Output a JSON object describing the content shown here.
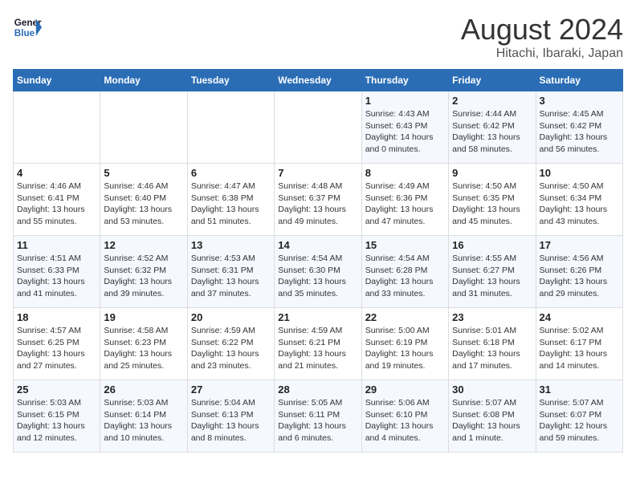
{
  "header": {
    "logo_line1": "General",
    "logo_line2": "Blue",
    "title": "August 2024",
    "subtitle": "Hitachi, Ibaraki, Japan"
  },
  "weekdays": [
    "Sunday",
    "Monday",
    "Tuesday",
    "Wednesday",
    "Thursday",
    "Friday",
    "Saturday"
  ],
  "weeks": [
    [
      {
        "day": "",
        "detail": ""
      },
      {
        "day": "",
        "detail": ""
      },
      {
        "day": "",
        "detail": ""
      },
      {
        "day": "",
        "detail": ""
      },
      {
        "day": "1",
        "detail": "Sunrise: 4:43 AM\nSunset: 6:43 PM\nDaylight: 14 hours\nand 0 minutes."
      },
      {
        "day": "2",
        "detail": "Sunrise: 4:44 AM\nSunset: 6:42 PM\nDaylight: 13 hours\nand 58 minutes."
      },
      {
        "day": "3",
        "detail": "Sunrise: 4:45 AM\nSunset: 6:42 PM\nDaylight: 13 hours\nand 56 minutes."
      }
    ],
    [
      {
        "day": "4",
        "detail": "Sunrise: 4:46 AM\nSunset: 6:41 PM\nDaylight: 13 hours\nand 55 minutes."
      },
      {
        "day": "5",
        "detail": "Sunrise: 4:46 AM\nSunset: 6:40 PM\nDaylight: 13 hours\nand 53 minutes."
      },
      {
        "day": "6",
        "detail": "Sunrise: 4:47 AM\nSunset: 6:38 PM\nDaylight: 13 hours\nand 51 minutes."
      },
      {
        "day": "7",
        "detail": "Sunrise: 4:48 AM\nSunset: 6:37 PM\nDaylight: 13 hours\nand 49 minutes."
      },
      {
        "day": "8",
        "detail": "Sunrise: 4:49 AM\nSunset: 6:36 PM\nDaylight: 13 hours\nand 47 minutes."
      },
      {
        "day": "9",
        "detail": "Sunrise: 4:50 AM\nSunset: 6:35 PM\nDaylight: 13 hours\nand 45 minutes."
      },
      {
        "day": "10",
        "detail": "Sunrise: 4:50 AM\nSunset: 6:34 PM\nDaylight: 13 hours\nand 43 minutes."
      }
    ],
    [
      {
        "day": "11",
        "detail": "Sunrise: 4:51 AM\nSunset: 6:33 PM\nDaylight: 13 hours\nand 41 minutes."
      },
      {
        "day": "12",
        "detail": "Sunrise: 4:52 AM\nSunset: 6:32 PM\nDaylight: 13 hours\nand 39 minutes."
      },
      {
        "day": "13",
        "detail": "Sunrise: 4:53 AM\nSunset: 6:31 PM\nDaylight: 13 hours\nand 37 minutes."
      },
      {
        "day": "14",
        "detail": "Sunrise: 4:54 AM\nSunset: 6:30 PM\nDaylight: 13 hours\nand 35 minutes."
      },
      {
        "day": "15",
        "detail": "Sunrise: 4:54 AM\nSunset: 6:28 PM\nDaylight: 13 hours\nand 33 minutes."
      },
      {
        "day": "16",
        "detail": "Sunrise: 4:55 AM\nSunset: 6:27 PM\nDaylight: 13 hours\nand 31 minutes."
      },
      {
        "day": "17",
        "detail": "Sunrise: 4:56 AM\nSunset: 6:26 PM\nDaylight: 13 hours\nand 29 minutes."
      }
    ],
    [
      {
        "day": "18",
        "detail": "Sunrise: 4:57 AM\nSunset: 6:25 PM\nDaylight: 13 hours\nand 27 minutes."
      },
      {
        "day": "19",
        "detail": "Sunrise: 4:58 AM\nSunset: 6:23 PM\nDaylight: 13 hours\nand 25 minutes."
      },
      {
        "day": "20",
        "detail": "Sunrise: 4:59 AM\nSunset: 6:22 PM\nDaylight: 13 hours\nand 23 minutes."
      },
      {
        "day": "21",
        "detail": "Sunrise: 4:59 AM\nSunset: 6:21 PM\nDaylight: 13 hours\nand 21 minutes."
      },
      {
        "day": "22",
        "detail": "Sunrise: 5:00 AM\nSunset: 6:19 PM\nDaylight: 13 hours\nand 19 minutes."
      },
      {
        "day": "23",
        "detail": "Sunrise: 5:01 AM\nSunset: 6:18 PM\nDaylight: 13 hours\nand 17 minutes."
      },
      {
        "day": "24",
        "detail": "Sunrise: 5:02 AM\nSunset: 6:17 PM\nDaylight: 13 hours\nand 14 minutes."
      }
    ],
    [
      {
        "day": "25",
        "detail": "Sunrise: 5:03 AM\nSunset: 6:15 PM\nDaylight: 13 hours\nand 12 minutes."
      },
      {
        "day": "26",
        "detail": "Sunrise: 5:03 AM\nSunset: 6:14 PM\nDaylight: 13 hours\nand 10 minutes."
      },
      {
        "day": "27",
        "detail": "Sunrise: 5:04 AM\nSunset: 6:13 PM\nDaylight: 13 hours\nand 8 minutes."
      },
      {
        "day": "28",
        "detail": "Sunrise: 5:05 AM\nSunset: 6:11 PM\nDaylight: 13 hours\nand 6 minutes."
      },
      {
        "day": "29",
        "detail": "Sunrise: 5:06 AM\nSunset: 6:10 PM\nDaylight: 13 hours\nand 4 minutes."
      },
      {
        "day": "30",
        "detail": "Sunrise: 5:07 AM\nSunset: 6:08 PM\nDaylight: 13 hours\nand 1 minute."
      },
      {
        "day": "31",
        "detail": "Sunrise: 5:07 AM\nSunset: 6:07 PM\nDaylight: 12 hours\nand 59 minutes."
      }
    ]
  ]
}
